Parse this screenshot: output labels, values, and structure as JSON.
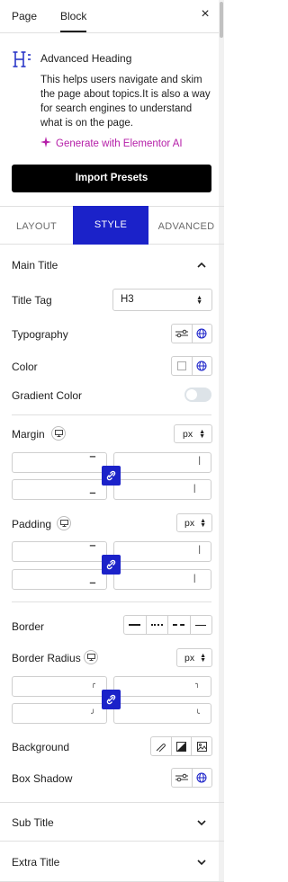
{
  "panel": {
    "top_tabs": [
      "Page",
      "Block"
    ],
    "close_glyph": "×"
  },
  "widget": {
    "icon": "heading-icon",
    "title": "Advanced Heading",
    "description": "This helps users navigate and skim the page about topics.It is also a way for search engines to understand what is on the page.",
    "ai_link": "Generate with Elementor AI",
    "import_button": "Import Presets"
  },
  "tabs": [
    "LAYOUT",
    "STYLE",
    "ADVANCED"
  ],
  "active_tab": "STYLE",
  "colors": {
    "accent": "#1b22c9",
    "ai": "#b51ea8",
    "button": "#000000"
  },
  "main_title": {
    "label": "Main Title",
    "title_tag_label": "Title Tag",
    "title_tag_value": "H3",
    "typography_label": "Typography",
    "color_label": "Color",
    "gradient_label": "Gradient Color",
    "gradient_enabled": false,
    "margin_label": "Margin",
    "margin_unit": "px",
    "padding_label": "Padding",
    "padding_unit": "px",
    "border_label": "Border",
    "border_radius_label": "Border Radius",
    "border_radius_unit": "px",
    "background_label": "Background",
    "box_shadow_label": "Box Shadow"
  },
  "sections": [
    "Sub Title",
    "Extra Title"
  ]
}
